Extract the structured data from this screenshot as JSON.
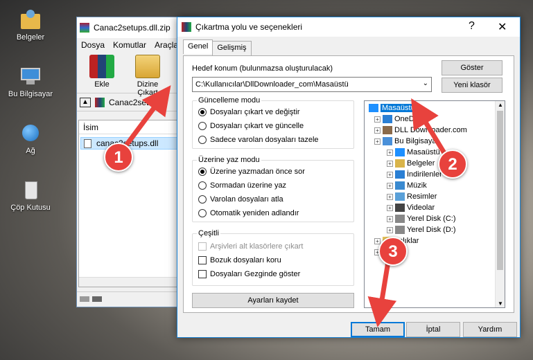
{
  "desktop": {
    "icons": [
      {
        "label": "Belgeler",
        "icon": "folder-user-icon"
      },
      {
        "label": "Bu Bilgisayar",
        "icon": "computer-icon"
      },
      {
        "label": "Ağ",
        "icon": "network-icon"
      },
      {
        "label": "Çöp Kutusu",
        "icon": "recycle-bin-icon"
      }
    ]
  },
  "winrar": {
    "title": "Canac2setups.dll.zip",
    "menu": [
      "Dosya",
      "Komutlar",
      "Araçlar"
    ],
    "tools": {
      "add": "Ekle",
      "extract": "Dizine Çıkart"
    },
    "address": "Canac2setu",
    "column_name": "İsim",
    "file": "canac2setups.dll"
  },
  "dialog": {
    "title": "Çıkartma yolu ve seçenekleri",
    "help": "?",
    "close": "✕",
    "tabs": [
      "Genel",
      "Gelişmiş"
    ],
    "dest_label": "Hedef konum (bulunmazsa oluşturulacak)",
    "dest_value": "C:\\Kullanıcılar\\DllDownloader_com\\Masaüstü",
    "show_button": "Göster",
    "new_folder_button": "Yeni klasör",
    "update_mode": {
      "legend": "Güncelleme modu",
      "options": [
        "Dosyaları çıkart ve değiştir",
        "Dosyaları çıkart ve güncelle",
        "Sadece varolan dosyaları tazele"
      ],
      "selected": 0
    },
    "overwrite_mode": {
      "legend": "Üzerine yaz modu",
      "options": [
        "Üzerine yazmadan önce sor",
        "Sormadan üzerine yaz",
        "Varolan dosyaları atla",
        "Otomatik yeniden adlandır"
      ],
      "selected": 0
    },
    "misc": {
      "legend": "Çeşitli",
      "options": [
        "Arşivleri alt klasörlere çıkart",
        "Bozuk dosyaları koru",
        "Dosyaları Gezginde göster"
      ]
    },
    "save_settings": "Ayarları kaydet",
    "tree": [
      {
        "label": "Masaüstü",
        "level": 0,
        "icon": "desktop-icon",
        "selected": true
      },
      {
        "label": "OneD",
        "level": 1,
        "icon": "onedrive-icon"
      },
      {
        "label": "DLL Downloader.com",
        "level": 1,
        "icon": "user-icon"
      },
      {
        "label": "Bu Bilgisaya",
        "level": 1,
        "icon": "computer-icon"
      },
      {
        "label": "Masaüstü",
        "level": 2,
        "icon": "desktop-icon"
      },
      {
        "label": "Belgeler",
        "level": 2,
        "icon": "documents-icon"
      },
      {
        "label": "İndirilenler",
        "level": 2,
        "icon": "downloads-icon"
      },
      {
        "label": "Müzik",
        "level": 2,
        "icon": "music-icon"
      },
      {
        "label": "Resimler",
        "level": 2,
        "icon": "pictures-icon"
      },
      {
        "label": "Videolar",
        "level": 2,
        "icon": "videos-icon"
      },
      {
        "label": "Yerel Disk (C:)",
        "level": 2,
        "icon": "drive-icon"
      },
      {
        "label": "Yerel Disk (D:)",
        "level": 2,
        "icon": "drive-icon"
      },
      {
        "label": "aplıklar",
        "level": 1,
        "icon": "folder-icon"
      },
      {
        "label": "",
        "level": 1,
        "icon": "folder-icon"
      }
    ],
    "ok": "Tamam",
    "cancel": "İptal",
    "help_button": "Yardım"
  },
  "annotations": [
    "1",
    "2",
    "3"
  ],
  "colors": {
    "accent": "#0078d7",
    "annotation": "#e8423d",
    "selection": "#cce8ff"
  }
}
